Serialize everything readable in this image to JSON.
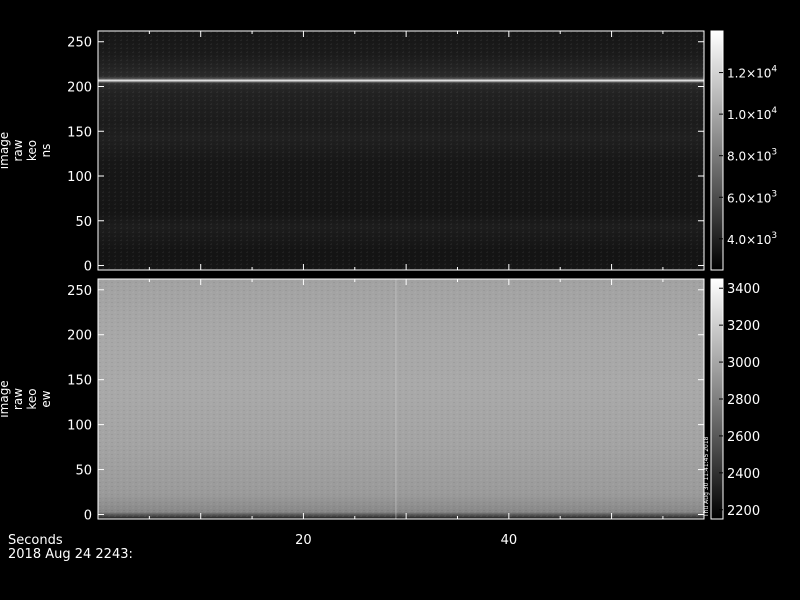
{
  "chart_data": [
    {
      "type": "heatmap",
      "ylabel_lines": [
        "image",
        "raw",
        "keo",
        "ns"
      ],
      "xlim": [
        0,
        59
      ],
      "ylim": [
        -5,
        262
      ],
      "yticks": [
        "0",
        "50",
        "100",
        "150",
        "200",
        "250"
      ],
      "ytick_values": [
        0,
        50,
        100,
        150,
        200,
        250
      ],
      "colorbar": {
        "range": [
          2500,
          14000
        ],
        "ticks": [
          {
            "value": 4000,
            "mant": "4.0",
            "exp": "3"
          },
          {
            "value": 6000,
            "mant": "6.0",
            "exp": "3"
          },
          {
            "value": 8000,
            "mant": "8.0",
            "exp": "3"
          },
          {
            "value": 10000,
            "mant": "1.0",
            "exp": "4"
          },
          {
            "value": 12000,
            "mant": "1.2",
            "exp": "4"
          }
        ]
      },
      "bright_band_y": 210,
      "colormap": "grayscale"
    },
    {
      "type": "heatmap",
      "ylabel_lines": [
        "image",
        "raw",
        "keo",
        "ew"
      ],
      "xlim": [
        0,
        59
      ],
      "ylim": [
        -5,
        262
      ],
      "yticks": [
        "0",
        "50",
        "100",
        "150",
        "200",
        "250"
      ],
      "ytick_values": [
        0,
        50,
        100,
        150,
        200,
        250
      ],
      "colorbar": {
        "range": [
          2150,
          3450
        ],
        "ticks": [
          "2200",
          "2400",
          "2600",
          "2800",
          "3000",
          "3200",
          "3400"
        ],
        "tick_values": [
          2200,
          2400,
          2600,
          2800,
          3000,
          3200,
          3400
        ]
      },
      "dark_band_y": 0,
      "vertical_streak_x": 29,
      "colormap": "grayscale"
    }
  ],
  "xaxis": {
    "label": "Seconds",
    "ticks": [
      "20",
      "40"
    ],
    "tick_values": [
      20,
      40
    ]
  },
  "footer": {
    "date": "2018 Aug 24 2243:",
    "stamp": "Thu Aug 30 11:41:45 2018"
  }
}
